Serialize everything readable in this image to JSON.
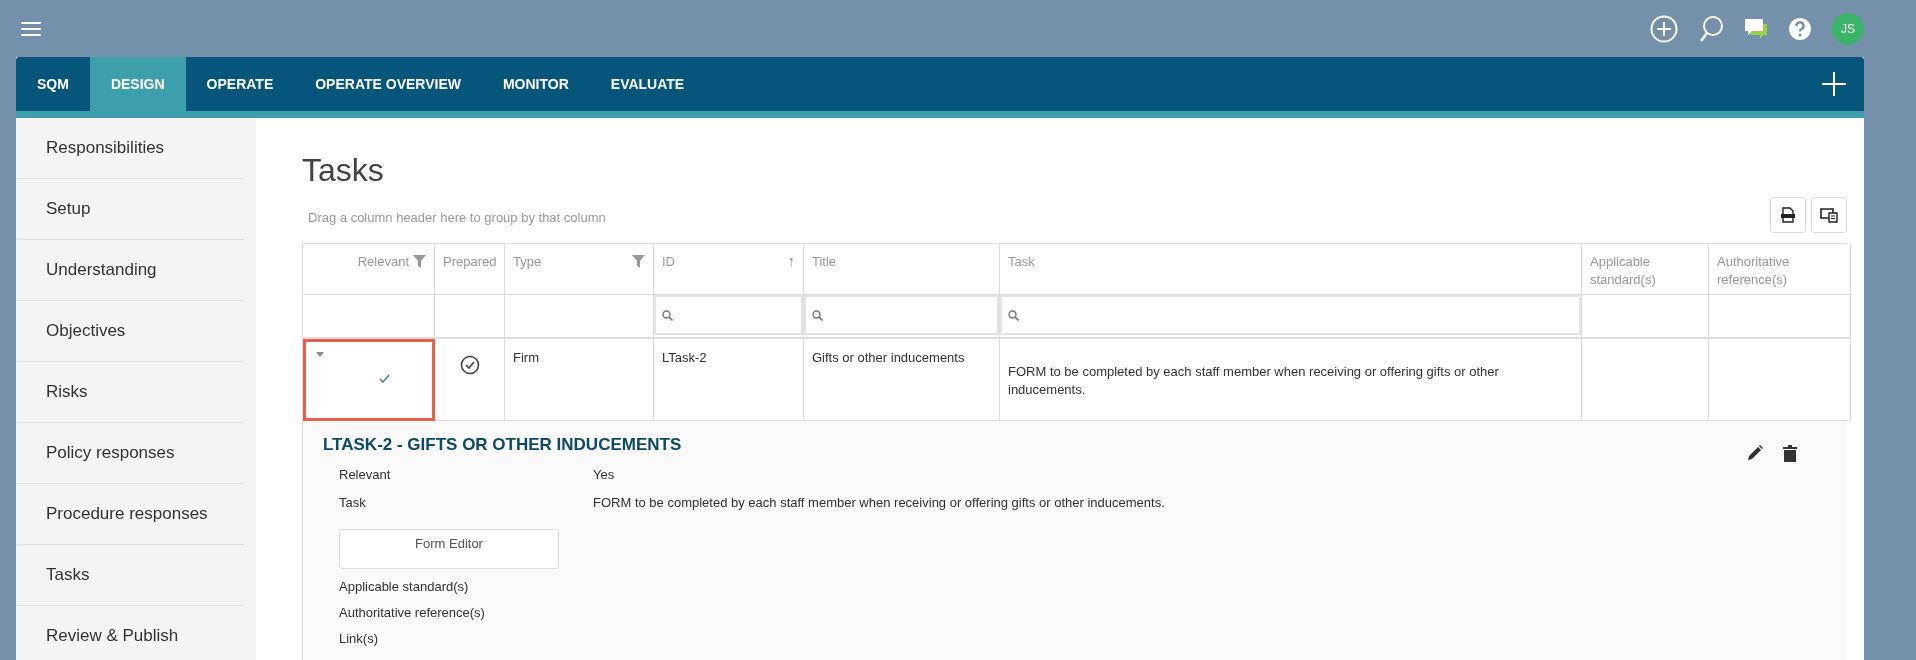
{
  "top_bar": {
    "avatar": "JS"
  },
  "nav": {
    "tabs": [
      {
        "label": "SQM",
        "selected": false
      },
      {
        "label": "DESIGN",
        "selected": true
      },
      {
        "label": "OPERATE",
        "selected": false
      },
      {
        "label": "OPERATE OVERVIEW",
        "selected": false
      },
      {
        "label": "MONITOR",
        "selected": false
      },
      {
        "label": "EVALUATE",
        "selected": false
      }
    ]
  },
  "sidebar": {
    "items": [
      "Responsibilities",
      "Setup",
      "Understanding",
      "Objectives",
      "Risks",
      "Policy responses",
      "Procedure responses",
      "Tasks",
      "Review & Publish"
    ]
  },
  "page": {
    "title": "Tasks",
    "group_hint": "Drag a column header here to group by that column"
  },
  "table": {
    "columns": [
      {
        "label": "Relevant",
        "filter": true,
        "searchable": false
      },
      {
        "label": "Prepared",
        "filter": false,
        "searchable": false
      },
      {
        "label": "Type",
        "filter": true,
        "searchable": false
      },
      {
        "label": "ID",
        "filter": false,
        "searchable": true,
        "sort_icon": "↑"
      },
      {
        "label": "Title",
        "filter": false,
        "searchable": true
      },
      {
        "label": "Task",
        "filter": false,
        "searchable": true
      },
      {
        "label": "Applicable standard(s)",
        "filter": false,
        "searchable": false
      },
      {
        "label": "Authoritative reference(s)",
        "filter": false,
        "searchable": false
      }
    ],
    "rows": [
      {
        "expanded": true,
        "focused": true,
        "relevant": true,
        "prepared": true,
        "type": "Firm",
        "id": "LTask-2",
        "title": "Gifts or other inducements",
        "task": "FORM to be completed by each staff member when receiving or offering gifts or other inducements."
      }
    ]
  },
  "detail": {
    "title": "LTASK-2 - GIFTS OR OTHER INDUCEMENTS",
    "fields": [
      {
        "label": "Relevant",
        "value": "Yes"
      },
      {
        "label": "Task",
        "value": "FORM to be completed by each staff member when receiving or offering gifts or other inducements."
      }
    ],
    "button": "Form Editor",
    "more_fields": [
      "Applicable standard(s)",
      "Authoritative reference(s)",
      "Link(s)"
    ]
  }
}
